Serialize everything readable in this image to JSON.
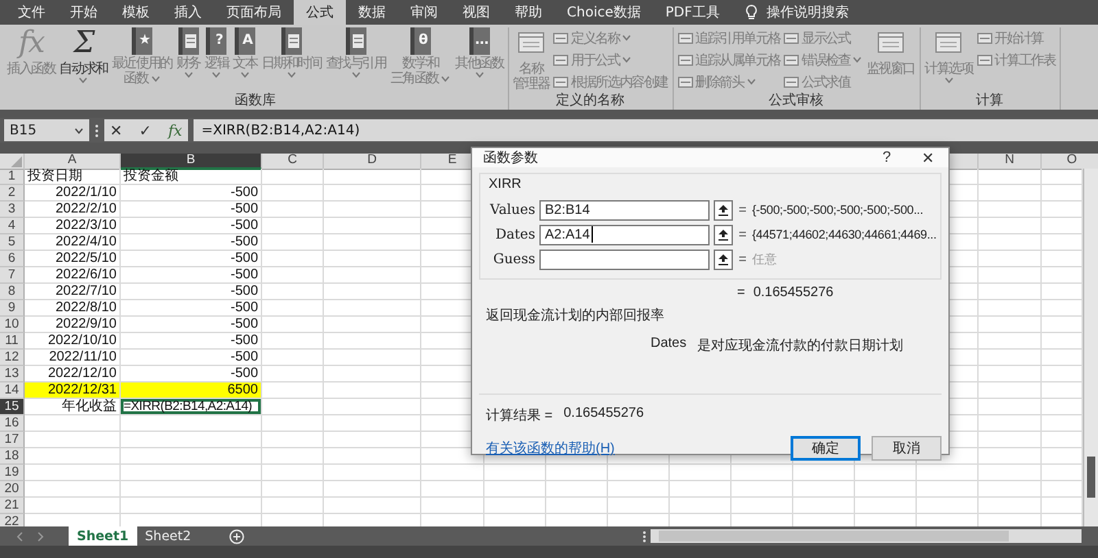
{
  "menu": {
    "tabs": [
      {
        "label": "文件",
        "selected": false
      },
      {
        "label": "开始",
        "selected": false
      },
      {
        "label": "模板",
        "selected": false
      },
      {
        "label": "插入",
        "selected": false
      },
      {
        "label": "页面布局",
        "selected": false
      },
      {
        "label": "公式",
        "selected": true
      },
      {
        "label": "数据",
        "selected": false
      },
      {
        "label": "审阅",
        "selected": false
      },
      {
        "label": "视图",
        "selected": false
      },
      {
        "label": "帮助",
        "selected": false
      },
      {
        "label": "Choice数据",
        "selected": false
      },
      {
        "label": "PDF工具",
        "selected": false
      }
    ],
    "search": {
      "label": "操作说明搜索"
    }
  },
  "ribbon": {
    "groups": [
      {
        "label": "函数库",
        "items": [
          {
            "kind": "big",
            "glyph": "fx",
            "lines": [
              "插入函数"
            ],
            "dropdown": false,
            "disabled": true
          },
          {
            "kind": "big",
            "glyph": "Σ",
            "lines": [
              "自动求和"
            ],
            "dropdown": true,
            "disabled": false
          },
          {
            "kind": "big",
            "glyph": "★",
            "lines": [
              "最近使用的",
              "函数"
            ],
            "dropdown": true,
            "disabled": true
          },
          {
            "kind": "big",
            "lines": [
              "财务"
            ],
            "dropdown": true,
            "disabled": true
          },
          {
            "kind": "big",
            "glyph": "?",
            "lines": [
              "逻辑"
            ],
            "dropdown": true,
            "disabled": true
          },
          {
            "kind": "big",
            "glyph": "A",
            "lines": [
              "文本"
            ],
            "dropdown": true,
            "disabled": true
          },
          {
            "kind": "big",
            "lines": [
              "日期和时间"
            ],
            "dropdown": true,
            "disabled": true
          },
          {
            "kind": "big",
            "lines": [
              "查找与引用"
            ],
            "dropdown": true,
            "disabled": true
          },
          {
            "kind": "big",
            "glyph": "θ",
            "lines": [
              "数学和",
              "三角函数"
            ],
            "dropdown": true,
            "disabled": true
          },
          {
            "kind": "big",
            "glyph": "…",
            "lines": [
              "其他函数"
            ],
            "dropdown": true,
            "disabled": true
          }
        ]
      },
      {
        "label": "定义的名称",
        "items": [
          {
            "kind": "big",
            "lines": [
              "名称",
              "管理器"
            ],
            "dropdown": false,
            "disabled": true
          },
          {
            "kind": "small",
            "label": "定义名称",
            "dropdown": true,
            "disabled": true
          },
          {
            "kind": "small",
            "label": "用于公式",
            "dropdown": true,
            "disabled": true
          },
          {
            "kind": "small",
            "label": "根据所选内容创建",
            "dropdown": false,
            "disabled": true
          }
        ]
      },
      {
        "label": "公式审核",
        "items": [
          {
            "kind": "small",
            "label": "追踪引用单元格",
            "dropdown": false,
            "disabled": true
          },
          {
            "kind": "small",
            "label": "追踪从属单元格",
            "dropdown": false,
            "disabled": true
          },
          {
            "kind": "small",
            "label": "删除箭头",
            "dropdown": true,
            "disabled": true
          },
          {
            "kind": "small",
            "label": "显示公式",
            "dropdown": false,
            "disabled": true
          },
          {
            "kind": "small",
            "label": "错误检查",
            "dropdown": true,
            "disabled": true
          },
          {
            "kind": "small",
            "label": "公式求值",
            "dropdown": false,
            "disabled": true
          },
          {
            "kind": "big",
            "lines": [
              "监视窗口"
            ],
            "dropdown": false,
            "disabled": true
          }
        ]
      },
      {
        "label": "计算",
        "items": [
          {
            "kind": "big",
            "lines": [
              "计算选项"
            ],
            "dropdown": true,
            "disabled": true
          },
          {
            "kind": "small",
            "label": "开始计算",
            "dropdown": false,
            "disabled": true
          },
          {
            "kind": "small",
            "label": "计算工作表",
            "dropdown": false,
            "disabled": true
          }
        ]
      }
    ]
  },
  "formula_bar": {
    "name_box": "B15",
    "cancel": "✕",
    "enter": "✓",
    "function": "fx",
    "formula": "=XIRR(B2:B14,A2:A14)"
  },
  "sheet": {
    "columns": [
      {
        "label": "A",
        "selected": false
      },
      {
        "label": "B",
        "selected": true
      },
      {
        "label": "C",
        "selected": false
      },
      {
        "label": "D",
        "selected": false
      },
      {
        "label": "E",
        "selected": false
      },
      {
        "label": "N",
        "selected": false
      },
      {
        "label": "O",
        "selected": false
      }
    ],
    "rows": [
      {
        "header": "1",
        "selected": false,
        "cells": [
          {
            "text": "投资日期",
            "kind": "text"
          },
          {
            "text": "投资金额",
            "kind": "text"
          }
        ]
      },
      {
        "header": "2",
        "selected": false,
        "cells": [
          {
            "text": "2022/1/10",
            "kind": "number"
          },
          {
            "text": "-500",
            "kind": "number"
          }
        ]
      },
      {
        "header": "3",
        "selected": false,
        "cells": [
          {
            "text": "2022/2/10",
            "kind": "number"
          },
          {
            "text": "-500",
            "kind": "number"
          }
        ]
      },
      {
        "header": "4",
        "selected": false,
        "cells": [
          {
            "text": "2022/3/10",
            "kind": "number"
          },
          {
            "text": "-500",
            "kind": "number"
          }
        ]
      },
      {
        "header": "5",
        "selected": false,
        "cells": [
          {
            "text": "2022/4/10",
            "kind": "number"
          },
          {
            "text": "-500",
            "kind": "number"
          }
        ]
      },
      {
        "header": "6",
        "selected": false,
        "cells": [
          {
            "text": "2022/5/10",
            "kind": "number"
          },
          {
            "text": "-500",
            "kind": "number"
          }
        ]
      },
      {
        "header": "7",
        "selected": false,
        "cells": [
          {
            "text": "2022/6/10",
            "kind": "number"
          },
          {
            "text": "-500",
            "kind": "number"
          }
        ]
      },
      {
        "header": "8",
        "selected": false,
        "cells": [
          {
            "text": "2022/7/10",
            "kind": "number"
          },
          {
            "text": "-500",
            "kind": "number"
          }
        ]
      },
      {
        "header": "9",
        "selected": false,
        "cells": [
          {
            "text": "2022/8/10",
            "kind": "number"
          },
          {
            "text": "-500",
            "kind": "number"
          }
        ]
      },
      {
        "header": "10",
        "selected": false,
        "cells": [
          {
            "text": "2022/9/10",
            "kind": "number"
          },
          {
            "text": "-500",
            "kind": "number"
          }
        ]
      },
      {
        "header": "11",
        "selected": false,
        "cells": [
          {
            "text": "2022/10/10",
            "kind": "number"
          },
          {
            "text": "-500",
            "kind": "number"
          }
        ]
      },
      {
        "header": "12",
        "selected": false,
        "cells": [
          {
            "text": "2022/11/10",
            "kind": "number"
          },
          {
            "text": "-500",
            "kind": "number"
          }
        ]
      },
      {
        "header": "13",
        "selected": false,
        "cells": [
          {
            "text": "2022/12/10",
            "kind": "number"
          },
          {
            "text": "-500",
            "kind": "number"
          }
        ]
      },
      {
        "header": "14",
        "selected": false,
        "cells": [
          {
            "text": "2022/12/31",
            "kind": "number",
            "color": "#ffff00"
          },
          {
            "text": "6500",
            "kind": "number",
            "color": "#ffff00"
          }
        ]
      },
      {
        "header": "15",
        "selected": true,
        "cells": [
          {
            "text": "年化收益",
            "kind": "caption",
            "selected": false
          },
          {
            "text": "=XIRR(B2:B14,A2:A14)",
            "kind": "formula",
            "selected": true
          }
        ]
      },
      {
        "header": "16",
        "selected": false
      },
      {
        "header": "17",
        "selected": false
      },
      {
        "header": "18",
        "selected": false
      },
      {
        "header": "19",
        "selected": false
      },
      {
        "header": "20",
        "selected": false
      },
      {
        "header": "21",
        "selected": false
      },
      {
        "header": "22",
        "selected": false
      }
    ]
  },
  "sheet_tabs": [
    {
      "label": "Sheet1",
      "selected": true
    },
    {
      "label": "Sheet2",
      "selected": false
    }
  ],
  "dialog": {
    "title": "函数参数",
    "help": "?",
    "close": "✕",
    "function": "XIRR",
    "args": [
      {
        "label": "Values",
        "value": "B2:B14",
        "focused": false,
        "eq": "=",
        "result": "{-500;-500;-500;-500;-500;-500...",
        "kind": "value"
      },
      {
        "label": "Dates",
        "value": "A2:A14",
        "focused": true,
        "eq": "=",
        "result": "{44571;44602;44630;44661;4469...",
        "kind": "value"
      },
      {
        "label": "Guess",
        "focused": false,
        "eq": "=",
        "result": "任意",
        "kind": "hint"
      }
    ],
    "result_eq": "=",
    "result": "0.165455276",
    "description": "返回现金流计划的内部回报率",
    "arg_name": "Dates",
    "arg_description": "是对应现金流付款的付款日期计划",
    "calc_label": "计算结果 =",
    "calc_value": "0.165455276",
    "help_link": "有关该函数的帮助(H)",
    "buttons": [
      {
        "label": "确定",
        "default": true
      },
      {
        "label": "取消",
        "default": false
      }
    ]
  }
}
